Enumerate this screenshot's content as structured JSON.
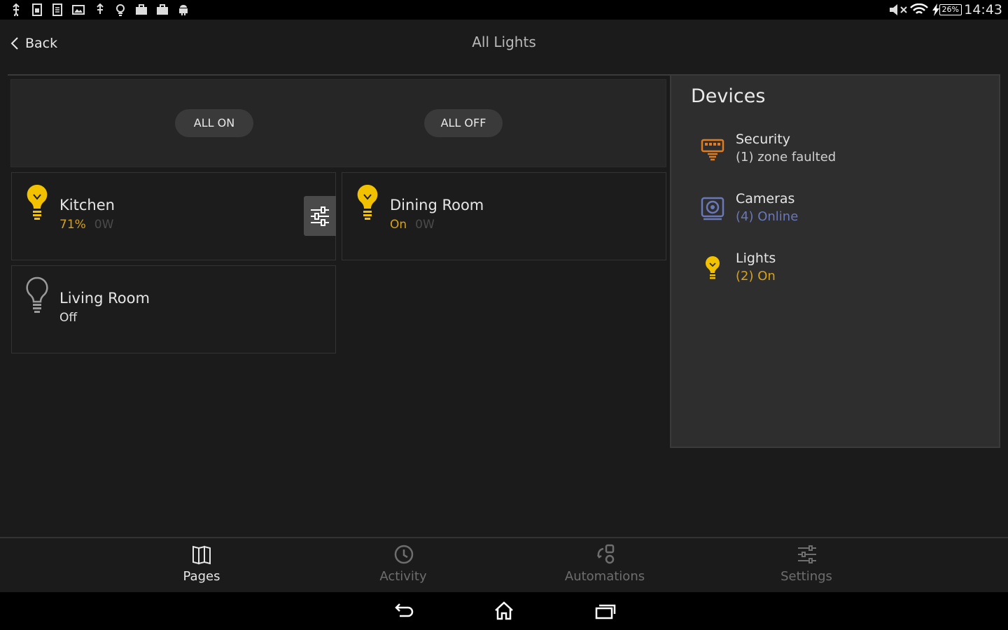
{
  "status_bar": {
    "time": "14:43",
    "battery": "26%",
    "left_icons": [
      "usb-icon",
      "sim-icon",
      "sim2-icon",
      "image-icon",
      "usb2-icon",
      "bulb-icon",
      "briefcase-icon",
      "briefcase2-icon",
      "android-icon"
    ],
    "right_icons": [
      "mute-icon",
      "wifi-icon",
      "charging-icon"
    ]
  },
  "header": {
    "back_label": "Back",
    "title": "All Lights"
  },
  "controls": {
    "all_on": "ALL ON",
    "all_off": "ALL OFF"
  },
  "lights": [
    {
      "name": "Kitchen",
      "state": "71%",
      "watts": "0W",
      "state_color": "#d6a21c",
      "on": true
    },
    {
      "name": "Dining Room",
      "state": "On",
      "watts": "0W",
      "state_color": "#d6a21c",
      "on": true
    },
    {
      "name": "Living Room",
      "state": "Off",
      "watts": "",
      "state_color": "#e0e0e0",
      "on": false
    }
  ],
  "devices": {
    "title": "Devices",
    "items": [
      {
        "name": "Security",
        "status": "(1) zone faulted",
        "icon": "security-icon",
        "status_color": "#cfcfcf"
      },
      {
        "name": "Cameras",
        "status": "(4) Online",
        "icon": "camera-icon",
        "status_color": "#6a78b8"
      },
      {
        "name": "Lights",
        "status": "(2) On",
        "icon": "bulb-icon",
        "status_color": "#d6a21c"
      }
    ]
  },
  "tabs": [
    {
      "label": "Pages",
      "icon": "pages-icon",
      "active": true
    },
    {
      "label": "Activity",
      "icon": "clock-icon",
      "active": false
    },
    {
      "label": "Automations",
      "icon": "automations-icon",
      "active": false
    },
    {
      "label": "Settings",
      "icon": "sliders-icon",
      "active": false
    }
  ],
  "colors": {
    "accent": "#f2c200",
    "camera": "#6a78b8",
    "security": "#e07b1f"
  }
}
